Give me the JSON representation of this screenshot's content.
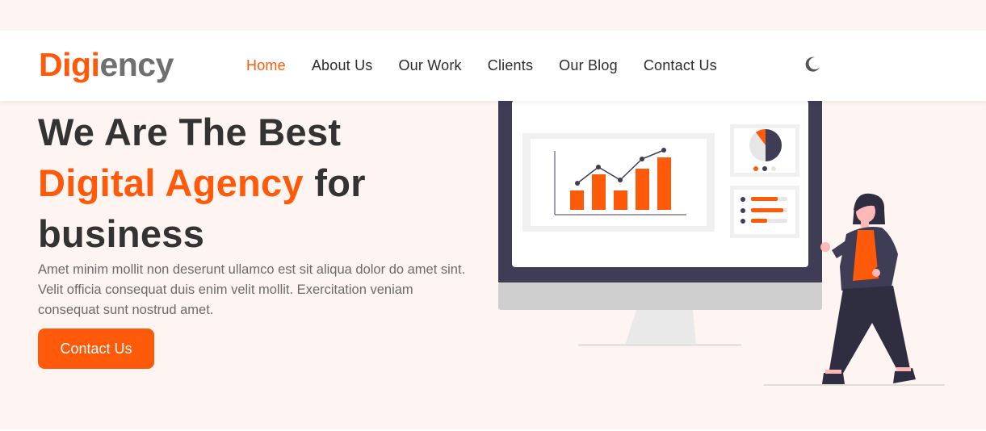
{
  "brand": {
    "part1": "Digi",
    "part2": "ency"
  },
  "nav": {
    "items": [
      {
        "label": "Home",
        "active": true
      },
      {
        "label": "About Us",
        "active": false
      },
      {
        "label": "Our Work",
        "active": false
      },
      {
        "label": "Clients",
        "active": false
      },
      {
        "label": "Our Blog",
        "active": false
      },
      {
        "label": "Contact Us",
        "active": false
      }
    ],
    "theme_icon": "moon-icon"
  },
  "hero": {
    "title_line1": "We Are The Best",
    "title_accent": "Digital Agency",
    "title_rest": " for",
    "title_line3": "business",
    "description": "Amet minim mollit non deserunt ullamco est sit aliqua dolor do amet sint. Velit officia consequat duis enim velit mollit. Exercitation veniam consequat sunt nostrud amet.",
    "cta_label": "Contact Us"
  },
  "colors": {
    "accent": "#ff5a0a",
    "background": "#fef4f1",
    "text_dark": "#333333",
    "text_muted": "#6b6b6b"
  }
}
